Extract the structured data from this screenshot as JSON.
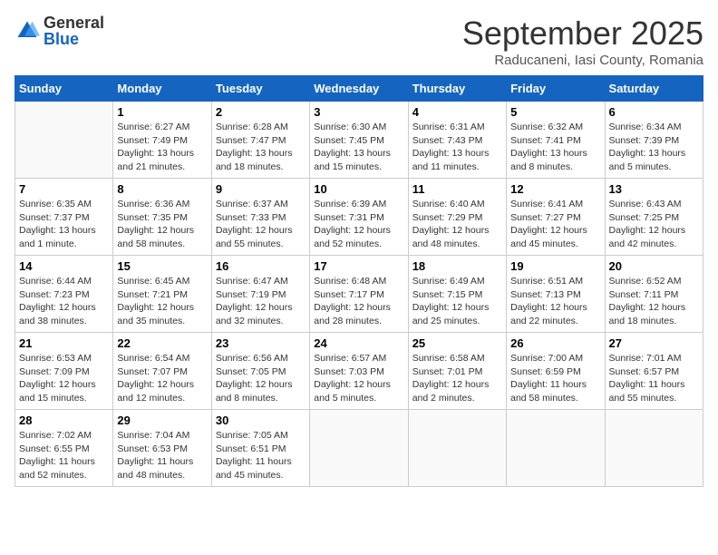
{
  "header": {
    "logo_general": "General",
    "logo_blue": "Blue",
    "month_title": "September 2025",
    "subtitle": "Raducaneni, Iasi County, Romania"
  },
  "days_of_week": [
    "Sunday",
    "Monday",
    "Tuesday",
    "Wednesday",
    "Thursday",
    "Friday",
    "Saturday"
  ],
  "weeks": [
    [
      {
        "day": "",
        "detail": ""
      },
      {
        "day": "1",
        "detail": "Sunrise: 6:27 AM\nSunset: 7:49 PM\nDaylight: 13 hours\nand 21 minutes."
      },
      {
        "day": "2",
        "detail": "Sunrise: 6:28 AM\nSunset: 7:47 PM\nDaylight: 13 hours\nand 18 minutes."
      },
      {
        "day": "3",
        "detail": "Sunrise: 6:30 AM\nSunset: 7:45 PM\nDaylight: 13 hours\nand 15 minutes."
      },
      {
        "day": "4",
        "detail": "Sunrise: 6:31 AM\nSunset: 7:43 PM\nDaylight: 13 hours\nand 11 minutes."
      },
      {
        "day": "5",
        "detail": "Sunrise: 6:32 AM\nSunset: 7:41 PM\nDaylight: 13 hours\nand 8 minutes."
      },
      {
        "day": "6",
        "detail": "Sunrise: 6:34 AM\nSunset: 7:39 PM\nDaylight: 13 hours\nand 5 minutes."
      }
    ],
    [
      {
        "day": "7",
        "detail": "Sunrise: 6:35 AM\nSunset: 7:37 PM\nDaylight: 13 hours\nand 1 minute."
      },
      {
        "day": "8",
        "detail": "Sunrise: 6:36 AM\nSunset: 7:35 PM\nDaylight: 12 hours\nand 58 minutes."
      },
      {
        "day": "9",
        "detail": "Sunrise: 6:37 AM\nSunset: 7:33 PM\nDaylight: 12 hours\nand 55 minutes."
      },
      {
        "day": "10",
        "detail": "Sunrise: 6:39 AM\nSunset: 7:31 PM\nDaylight: 12 hours\nand 52 minutes."
      },
      {
        "day": "11",
        "detail": "Sunrise: 6:40 AM\nSunset: 7:29 PM\nDaylight: 12 hours\nand 48 minutes."
      },
      {
        "day": "12",
        "detail": "Sunrise: 6:41 AM\nSunset: 7:27 PM\nDaylight: 12 hours\nand 45 minutes."
      },
      {
        "day": "13",
        "detail": "Sunrise: 6:43 AM\nSunset: 7:25 PM\nDaylight: 12 hours\nand 42 minutes."
      }
    ],
    [
      {
        "day": "14",
        "detail": "Sunrise: 6:44 AM\nSunset: 7:23 PM\nDaylight: 12 hours\nand 38 minutes."
      },
      {
        "day": "15",
        "detail": "Sunrise: 6:45 AM\nSunset: 7:21 PM\nDaylight: 12 hours\nand 35 minutes."
      },
      {
        "day": "16",
        "detail": "Sunrise: 6:47 AM\nSunset: 7:19 PM\nDaylight: 12 hours\nand 32 minutes."
      },
      {
        "day": "17",
        "detail": "Sunrise: 6:48 AM\nSunset: 7:17 PM\nDaylight: 12 hours\nand 28 minutes."
      },
      {
        "day": "18",
        "detail": "Sunrise: 6:49 AM\nSunset: 7:15 PM\nDaylight: 12 hours\nand 25 minutes."
      },
      {
        "day": "19",
        "detail": "Sunrise: 6:51 AM\nSunset: 7:13 PM\nDaylight: 12 hours\nand 22 minutes."
      },
      {
        "day": "20",
        "detail": "Sunrise: 6:52 AM\nSunset: 7:11 PM\nDaylight: 12 hours\nand 18 minutes."
      }
    ],
    [
      {
        "day": "21",
        "detail": "Sunrise: 6:53 AM\nSunset: 7:09 PM\nDaylight: 12 hours\nand 15 minutes."
      },
      {
        "day": "22",
        "detail": "Sunrise: 6:54 AM\nSunset: 7:07 PM\nDaylight: 12 hours\nand 12 minutes."
      },
      {
        "day": "23",
        "detail": "Sunrise: 6:56 AM\nSunset: 7:05 PM\nDaylight: 12 hours\nand 8 minutes."
      },
      {
        "day": "24",
        "detail": "Sunrise: 6:57 AM\nSunset: 7:03 PM\nDaylight: 12 hours\nand 5 minutes."
      },
      {
        "day": "25",
        "detail": "Sunrise: 6:58 AM\nSunset: 7:01 PM\nDaylight: 12 hours\nand 2 minutes."
      },
      {
        "day": "26",
        "detail": "Sunrise: 7:00 AM\nSunset: 6:59 PM\nDaylight: 11 hours\nand 58 minutes."
      },
      {
        "day": "27",
        "detail": "Sunrise: 7:01 AM\nSunset: 6:57 PM\nDaylight: 11 hours\nand 55 minutes."
      }
    ],
    [
      {
        "day": "28",
        "detail": "Sunrise: 7:02 AM\nSunset: 6:55 PM\nDaylight: 11 hours\nand 52 minutes."
      },
      {
        "day": "29",
        "detail": "Sunrise: 7:04 AM\nSunset: 6:53 PM\nDaylight: 11 hours\nand 48 minutes."
      },
      {
        "day": "30",
        "detail": "Sunrise: 7:05 AM\nSunset: 6:51 PM\nDaylight: 11 hours\nand 45 minutes."
      },
      {
        "day": "",
        "detail": ""
      },
      {
        "day": "",
        "detail": ""
      },
      {
        "day": "",
        "detail": ""
      },
      {
        "day": "",
        "detail": ""
      }
    ]
  ]
}
